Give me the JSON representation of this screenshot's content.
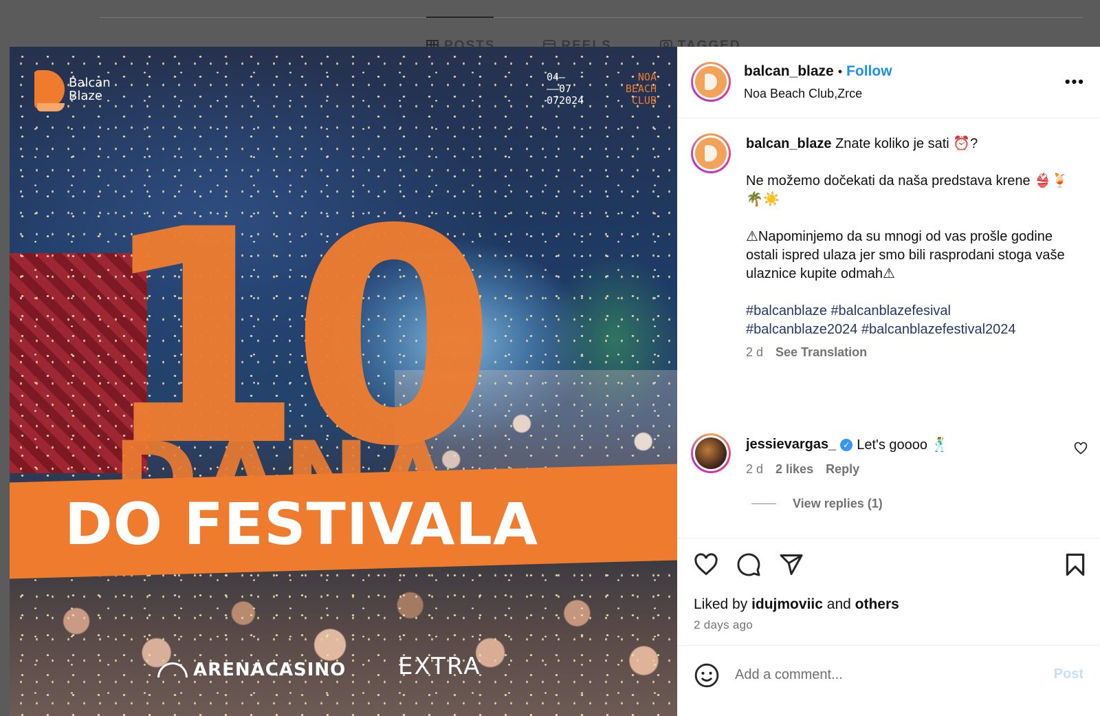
{
  "background": {
    "tabs": [
      {
        "label": "POSTS",
        "icon": "grid-icon"
      },
      {
        "label": "REELS",
        "icon": "reels-icon"
      },
      {
        "label": "TAGGED",
        "icon": "tagged-icon"
      }
    ]
  },
  "media": {
    "brand_name": "Balcan Blaze",
    "date_lines": [
      "04—",
      "——07",
      "072024"
    ],
    "venue_lines": [
      "NOA",
      "BEACH",
      "CLUB"
    ],
    "headline_number": "10",
    "headline_word": "DANA",
    "headline_sub": "DO FESTIVALA",
    "sponsor_1": "ARENACASINO",
    "sponsor_2": "EXTRA"
  },
  "post": {
    "username": "balcan_blaze",
    "separator": "•",
    "follow_label": "Follow",
    "location": "Noa Beach Club,Zrce",
    "more_label": "•••",
    "caption_line_1": "Znate koliko je sati ⏰?",
    "caption_line_2": "Ne možemo dočekati da naša predstava krene 👙🍹🌴☀️",
    "caption_line_3": "⚠Napominjemo da su mnogi od vas prošle godine ostali ispred ulaza jer smo bili rasprodani stoga vaše ulaznice kupite odmah⚠",
    "hashtags_1": "#balcanblaze #balcanblazefesival",
    "hashtags_2": "#balcanblaze2024 #balcanblazefestival2024",
    "time_ago": "2 d",
    "see_translation": "See Translation"
  },
  "comment": {
    "username": "jessievargas_",
    "verified_mark": "✓",
    "text": "Let's goooo 🕺",
    "time_ago": "2 d",
    "likes": "2 likes",
    "reply_label": "Reply",
    "view_replies": "View replies (1)"
  },
  "actions": {
    "liked_prefix": "Liked by",
    "liked_user": "idujmoviic",
    "liked_and": "and",
    "liked_others": "others",
    "posted_ago": "2 days ago"
  },
  "comment_box": {
    "placeholder": "Add a comment...",
    "post_label": "Post"
  },
  "colors": {
    "accent_blue": "#1d90f0",
    "brand_orange": "#ef7c2e",
    "hashtag_blue": "#23386b"
  }
}
